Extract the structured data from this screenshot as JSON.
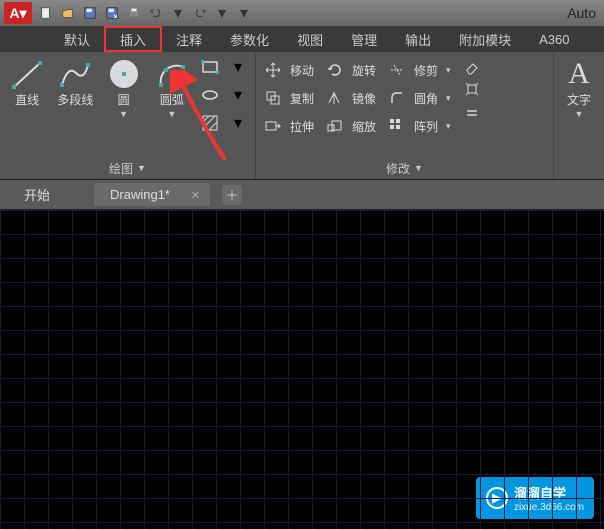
{
  "app": {
    "title": "Auto",
    "logo_letter": "A"
  },
  "qat": [
    "new",
    "open",
    "save",
    "saveas",
    "print",
    "undo",
    "redo"
  ],
  "menu": {
    "items": [
      "默认",
      "插入",
      "注释",
      "参数化",
      "视图",
      "管理",
      "输出",
      "附加模块",
      "A360"
    ],
    "highlighted_index": 1
  },
  "ribbon": {
    "draw": {
      "title": "绘图",
      "line": "直线",
      "polyline": "多段线",
      "circle": "圆",
      "arc": "圆弧"
    },
    "modify": {
      "title": "修改",
      "move": "移动",
      "rotate": "旋转",
      "trim": "修剪",
      "copy": "复制",
      "mirror": "镜像",
      "fillet": "圆角",
      "stretch": "拉伸",
      "scale": "缩放",
      "array": "阵列"
    },
    "annotate": {
      "text": "文字",
      "text_letter": "A"
    }
  },
  "tabs": {
    "start": "开始",
    "drawing": "Drawing1*"
  },
  "watermark": {
    "brand": "溜溜自学",
    "url": "zixue.3d66.com"
  }
}
